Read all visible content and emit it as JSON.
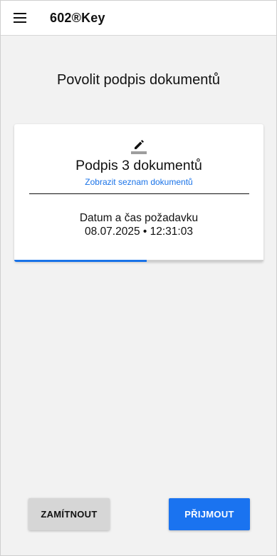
{
  "appbar": {
    "title": "602®Key",
    "menu_icon": "hamburger-menu-icon"
  },
  "page": {
    "title": "Povolit podpis dokumentů"
  },
  "request_card": {
    "icon": "pen-icon",
    "doc_count_text": "Podpis 3 dokumentů",
    "show_list_link": "Zobrazit seznam dokumentů",
    "date_label": "Datum a čas požadavku",
    "date_value": "08.07.2025 • 12:31:03",
    "progress_fraction": 0.53
  },
  "actions": {
    "reject_label": "ZAMÍTNOUT",
    "accept_label": "PŘIJMOUT"
  },
  "colors": {
    "accent": "#1a73e8",
    "background": "#f2f2f2",
    "reject_button": "#d6d6d6"
  }
}
